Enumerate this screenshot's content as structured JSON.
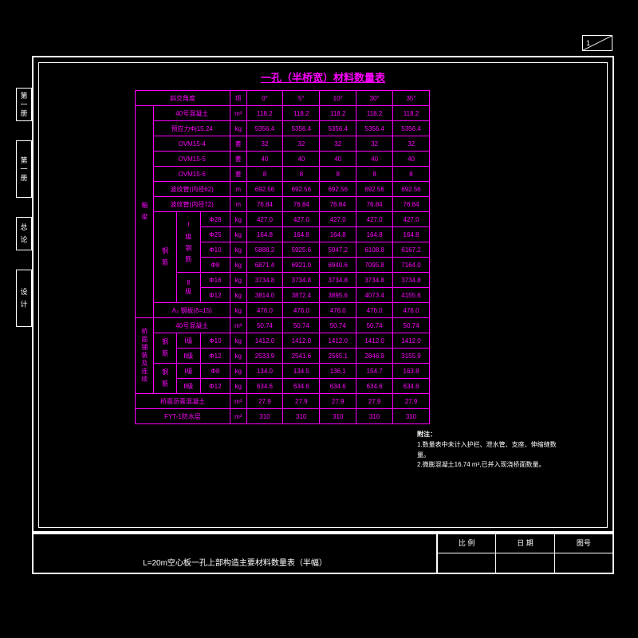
{
  "page_number": "1",
  "side_tabs": [
    "第一册",
    "第一册",
    "总 论",
    "设 计"
  ],
  "title": "一孔（半桥宽）材料数量表",
  "cols": [
    "斜交角度",
    "项",
    "0°",
    "5°",
    "10°",
    "30°",
    "35°"
  ],
  "group1": {
    "label": "箱 梁",
    "sublabel": "钢 筋",
    "rows": [
      [
        "40号混凝土",
        "m³",
        "118.2",
        "118.2",
        "118.2",
        "118.2",
        "118.2"
      ],
      [
        "预应力Φj15.24",
        "kg",
        "5356.4",
        "5356.4",
        "5356.4",
        "5356.4",
        "5356.4"
      ],
      [
        "OVM15-4",
        "套",
        "32",
        "32",
        "32",
        "32",
        "32"
      ],
      [
        "OVM15-5",
        "套",
        "40",
        "40",
        "40",
        "40",
        "40"
      ],
      [
        "OVM15-6",
        "套",
        "8",
        "8",
        "8",
        "8",
        "8"
      ],
      [
        "波纹管(内径62)",
        "m",
        "692.56",
        "692.56",
        "692.56",
        "692.56",
        "692.56"
      ],
      [
        "波纹管(内径72)",
        "m",
        "76.84",
        "76.84",
        "76.84",
        "76.84",
        "76.84"
      ]
    ],
    "I_label": "Ⅰ\n级\n钢\n筋",
    "II_label": "Ⅱ级",
    "I_rows": [
      [
        "Φ28",
        "kg",
        "427.0",
        "427.0",
        "427.0",
        "427.0",
        "427.0"
      ],
      [
        "Φ25",
        "kg",
        "164.8",
        "164.8",
        "164.8",
        "164.8",
        "164.8"
      ],
      [
        "Φ10",
        "kg",
        "5888.2",
        "5925.6",
        "5947.2",
        "6108.8",
        "6167.2"
      ],
      [
        "Φ8",
        "kg",
        "6871.4",
        "6921.0",
        "6940.6",
        "7095.8",
        "7164.0"
      ]
    ],
    "II_rows": [
      [
        "Φ16",
        "kg",
        "3734.8",
        "3734.8",
        "3734.8",
        "3734.8",
        "3734.8"
      ],
      [
        "Φ12",
        "kg",
        "3814.0",
        "3872.4",
        "3895.6",
        "4073.4",
        "4155.6"
      ]
    ],
    "A3": [
      "A₃ 钢板(δ=15)",
      "kg",
      "476.0",
      "476.0",
      "476.0",
      "476.0",
      "476.0"
    ]
  },
  "group2": {
    "label": "桥面铺装及连续",
    "rows": [
      [
        "40号混凝土",
        "m³",
        "50.74",
        "50.74",
        "50.74",
        "50.74",
        "50.74"
      ]
    ],
    "sub1_label": "钢\n筋",
    "sub1_rows": [
      [
        "Ⅰ级",
        "Φ10",
        "kg",
        "1412.0",
        "1412.0",
        "1412.0",
        "1412.0",
        "1412.0"
      ],
      [
        "Ⅱ级",
        "Φ12",
        "kg",
        "2533.9",
        "2541.6",
        "2565.1",
        "2846.9",
        "3155.9"
      ]
    ],
    "sub2_rows": [
      [
        "Ⅰ级",
        "Φ8",
        "kg",
        "134.0",
        "134.5",
        "136.1",
        "154.7",
        "163.8"
      ],
      [
        "Ⅱ级",
        "Φ12",
        "kg",
        "634.6",
        "634.6",
        "634.6",
        "634.6",
        "634.6"
      ]
    ],
    "tail": [
      [
        "桥面沥青混凝土",
        "m³",
        "27.9",
        "27.9",
        "27.9",
        "27.9",
        "27.9"
      ],
      [
        "FYT-1防水层",
        "m²",
        "310",
        "310",
        "310",
        "310",
        "310"
      ]
    ]
  },
  "notes": {
    "head": "附注：",
    "l1": "1.数量表中未计入护栏、泄水管、支座、伸缩缝数量。",
    "l2": "2.微膨混凝土16.74 m³,已并入现浇桥面数量。"
  },
  "titleblock": {
    "main": "L=20m空心板一孔上部构造主要材料数量表（半幅）",
    "scale_h": "比 例",
    "date_h": "日 期",
    "num_h": "图号",
    "scale": "",
    "date": "",
    "num": ""
  }
}
